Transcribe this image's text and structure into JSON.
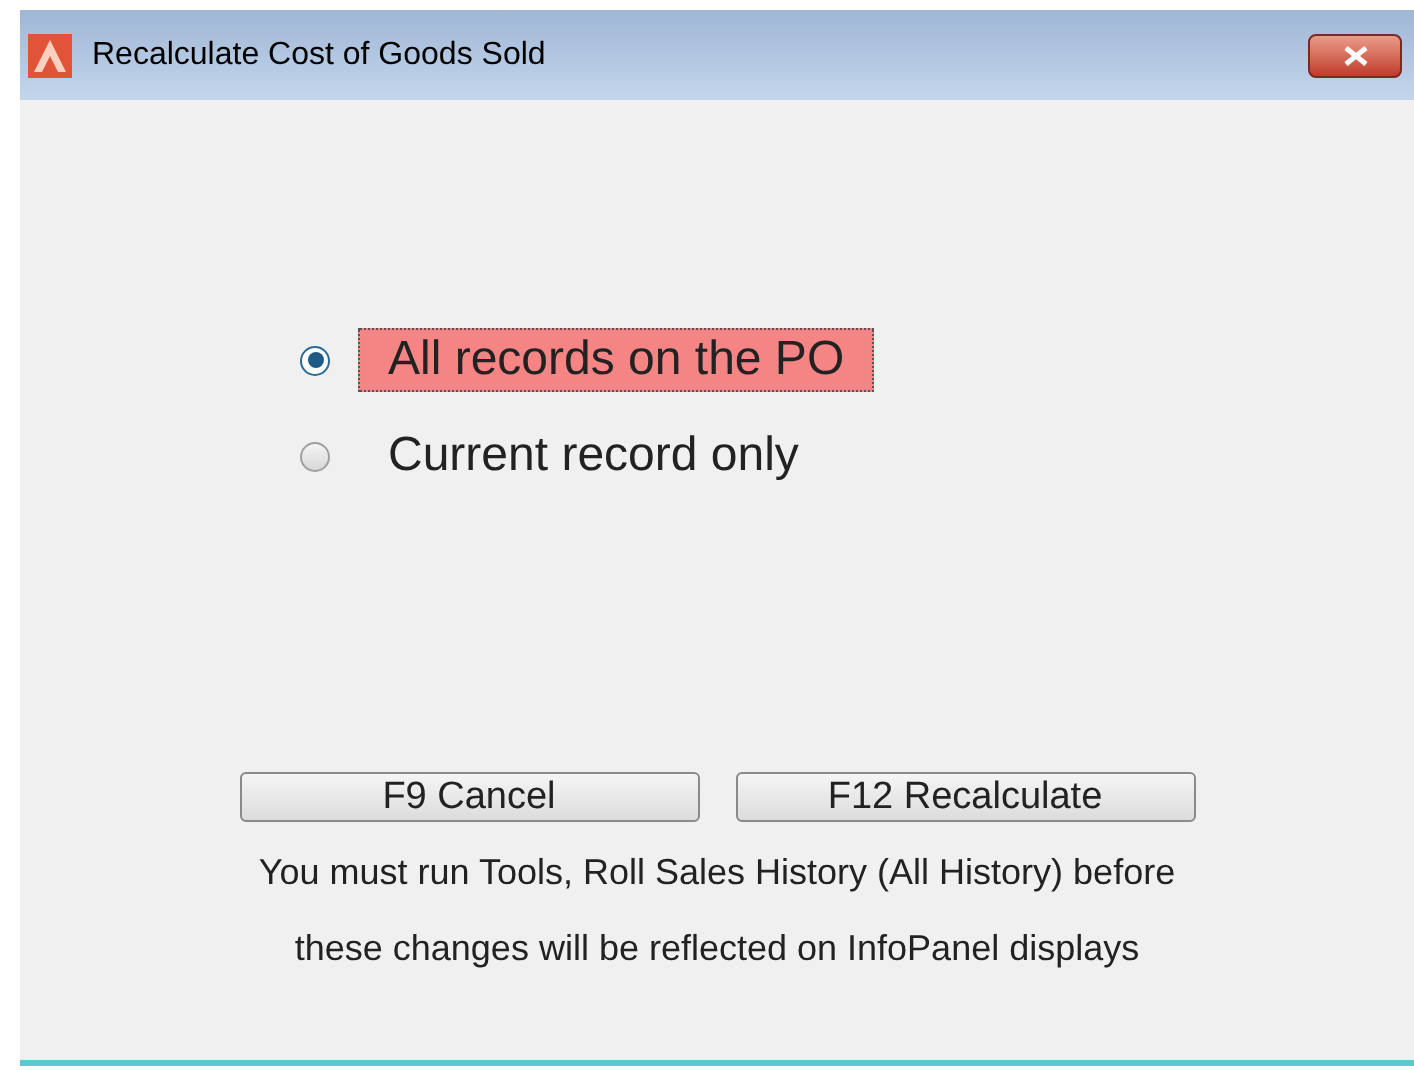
{
  "window": {
    "title": "Recalculate Cost of Goods Sold"
  },
  "options": [
    {
      "label": "All records on the PO",
      "selected": true,
      "focused": true
    },
    {
      "label": "Current record only",
      "selected": false,
      "focused": false
    }
  ],
  "buttons": [
    "F9 Cancel",
    "F12 Recalculate"
  ],
  "notice": [
    "You must run Tools, Roll Sales History (All History) before",
    "these changes will be reflected on InfoPanel displays"
  ]
}
